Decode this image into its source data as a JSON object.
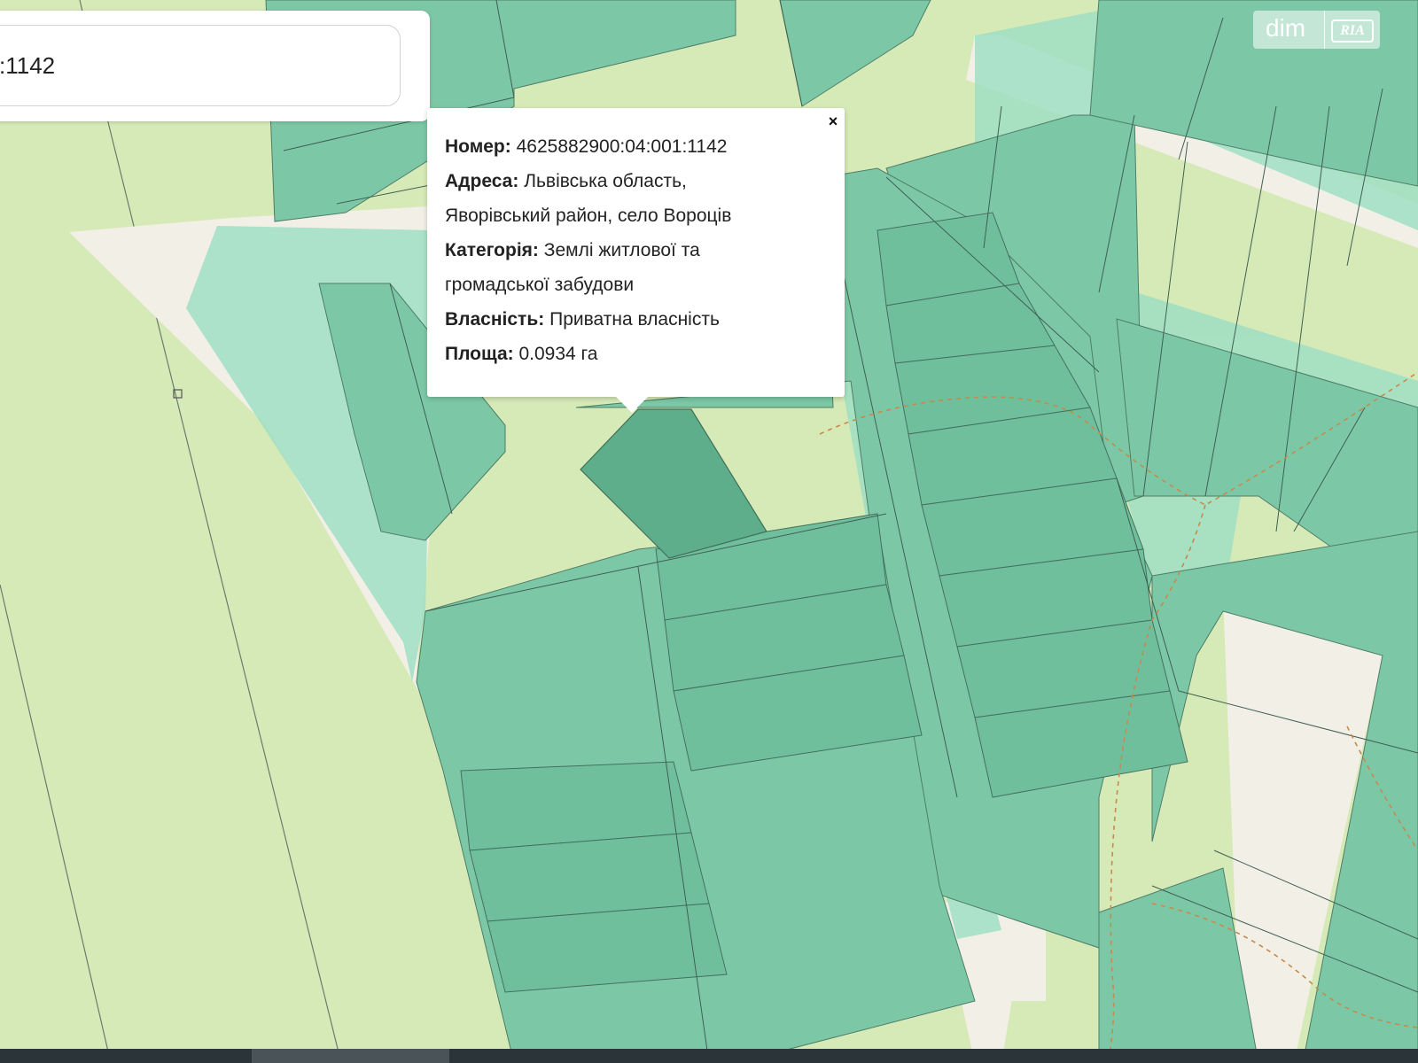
{
  "search": {
    "value": ":1142"
  },
  "popup": {
    "close_label": "×",
    "rows": [
      {
        "label": "Номер:",
        "value": "4625882900:04:001:1142"
      },
      {
        "label": "Адреса:",
        "value": "Львівська область,"
      },
      {
        "label": "",
        "value": "Яворівський район, село Вороців"
      },
      {
        "label": "Категорія:",
        "value": "Землі житлової та"
      },
      {
        "label": "",
        "value": "громадської забудови"
      },
      {
        "label": "Власність:",
        "value": "Приватна власність"
      },
      {
        "label": "Площа:",
        "value": "0.0934 га"
      }
    ]
  },
  "logo": {
    "text": "dim",
    "mark": "RIA"
  },
  "colors": {
    "farmland": "#d6eab8",
    "road": "#f2efe6",
    "zone": "#9fdfc3",
    "parcel": "#7cc8a6",
    "parcel_dark": "#6ab795",
    "selected_parcel": "#5fae8b",
    "path": "#c58a4c"
  }
}
